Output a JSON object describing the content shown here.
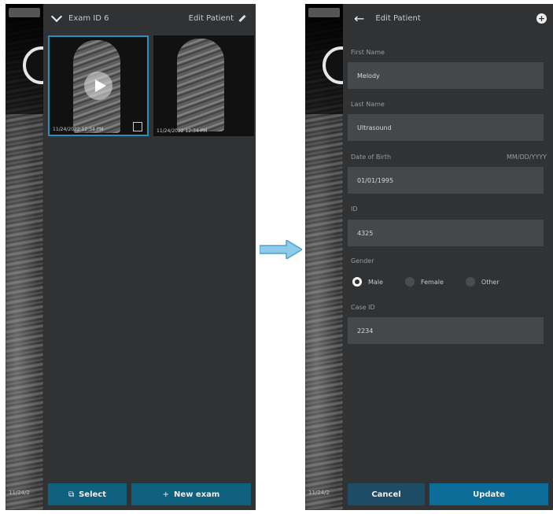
{
  "left_screen": {
    "header": {
      "title": "Exam ID 6",
      "edit_label": "Edit Patient"
    },
    "thumbnails": [
      {
        "caption": "11/24/2022 12:34 PM",
        "selected": true,
        "has_play": true
      },
      {
        "caption": "11/24/2022 12:34 PM",
        "selected": false,
        "has_play": false
      }
    ],
    "footer": {
      "select_label": "Select",
      "new_exam_label": "New exam"
    },
    "background_timestamp": "11/24/2"
  },
  "right_screen": {
    "header": {
      "title": "Edit Patient"
    },
    "fields": {
      "first_name": {
        "label": "First Name",
        "value": "Melody"
      },
      "last_name": {
        "label": "Last Name",
        "value": "Ultrasound"
      },
      "dob": {
        "label": "Date of Birth",
        "hint": "MM/DD/YYYY",
        "value": "01/01/1995"
      },
      "id": {
        "label": "ID",
        "value": "4325"
      },
      "gender": {
        "label": "Gender",
        "options": [
          "Male",
          "Female",
          "Other"
        ],
        "selected": "Male"
      },
      "case_id": {
        "label": "Case ID",
        "value": "2234"
      }
    },
    "footer": {
      "cancel_label": "Cancel",
      "update_label": "Update"
    },
    "background_timestamp": "11/24/2"
  },
  "colors": {
    "accent": "#10607f",
    "panel": "#303234",
    "field": "#45484b",
    "selection": "#2a8fbd",
    "arrow": "#6fb6dd"
  }
}
